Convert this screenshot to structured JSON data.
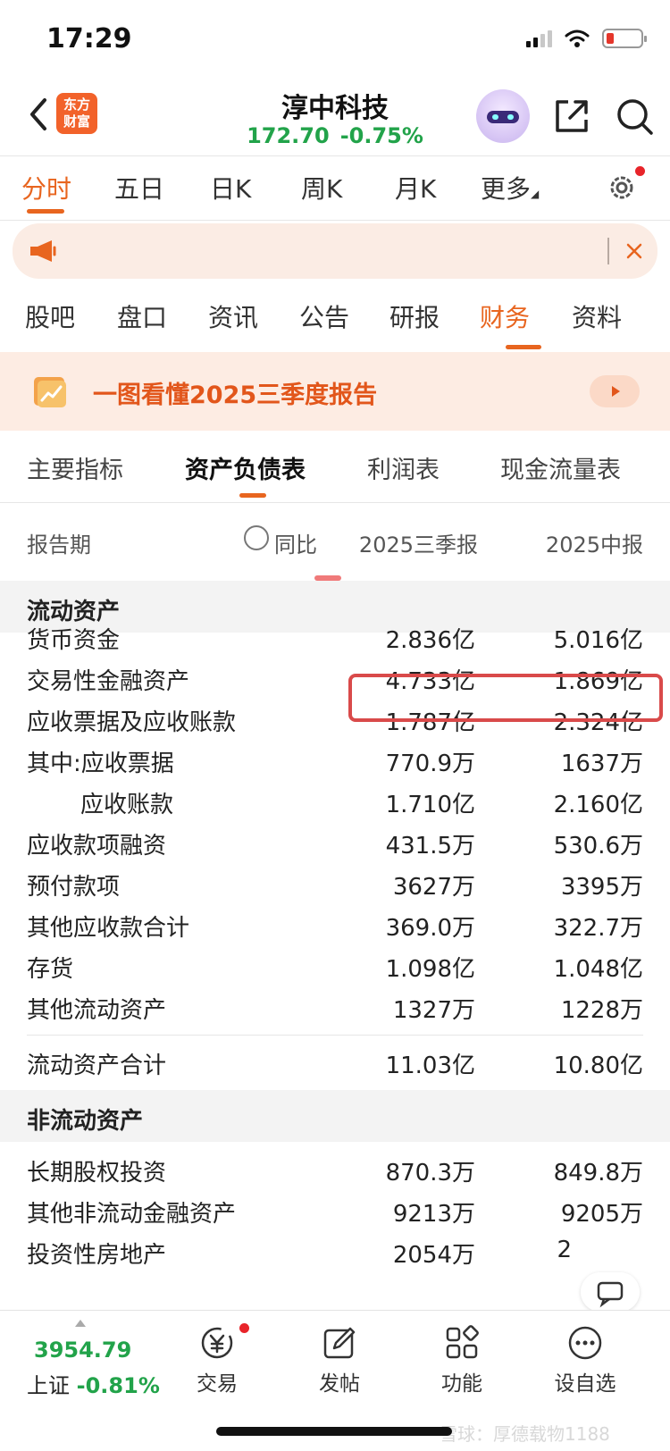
{
  "status_bar": {
    "time": "17:29"
  },
  "header": {
    "logo_text_line1": "东方",
    "logo_text_line2": "财富",
    "stock_name": "淳中科技",
    "price": "172.70",
    "change_pct": "-0.75%",
    "quote_color": "#22a34a"
  },
  "period_tabs": [
    "分时",
    "五日",
    "日K",
    "周K",
    "月K",
    "更多"
  ],
  "period_active": "分时",
  "section_tabs": [
    "股吧",
    "盘口",
    "资讯",
    "公告",
    "研报",
    "财务",
    "资料"
  ],
  "section_active": "财务",
  "banner": {
    "text": "一图看懂2025三季度报告"
  },
  "statement_tabs": [
    "主要指标",
    "资产负债表",
    "利润表",
    "现金流量表"
  ],
  "statement_active": "资产负债表",
  "columns": {
    "period_label": "报告期",
    "yoy_label": "同比",
    "col1": "2025三季报",
    "col2": "2025中报"
  },
  "current_assets": {
    "title": "流动资产",
    "rows": [
      {
        "name": "货币资金",
        "v1": "2.836亿",
        "v2": "5.016亿"
      },
      {
        "name": "交易性金融资产",
        "v1": "4.733亿",
        "v2": "1.869亿",
        "highlighted": true
      },
      {
        "name": "应收票据及应收账款",
        "v1": "1.787亿",
        "v2": "2.324亿"
      },
      {
        "name": "其中:应收票据",
        "v1": "770.9万",
        "v2": "1637万"
      },
      {
        "name": "应收账款",
        "v1": "1.710亿",
        "v2": "2.160亿",
        "indent": true
      },
      {
        "name": "应收款项融资",
        "v1": "431.5万",
        "v2": "530.6万"
      },
      {
        "name": "预付款项",
        "v1": "3627万",
        "v2": "3395万"
      },
      {
        "name": "其他应收款合计",
        "v1": "369.0万",
        "v2": "322.7万"
      },
      {
        "name": "存货",
        "v1": "1.098亿",
        "v2": "1.048亿"
      },
      {
        "name": "其他流动资产",
        "v1": "1327万",
        "v2": "1228万"
      }
    ],
    "total": {
      "name": "流动资产合计",
      "v1": "11.03亿",
      "v2": "10.80亿"
    }
  },
  "non_current_assets": {
    "title": "非流动资产",
    "rows": [
      {
        "name": "长期股权投资",
        "v1": "870.3万",
        "v2": "849.8万"
      },
      {
        "name": "其他非流动金融资产",
        "v1": "9213万",
        "v2": "9205万"
      },
      {
        "name": "投资性房地产",
        "v1": "2054万",
        "v2": "2"
      }
    ]
  },
  "bottom_bar": {
    "index_value": "3954.79",
    "index_name": "上证",
    "index_change": "-0.81%",
    "nav": [
      "交易",
      "发帖",
      "功能",
      "设自选"
    ]
  },
  "watermark": "雪球：厚德载物1188",
  "accent_color": "#e8651f"
}
